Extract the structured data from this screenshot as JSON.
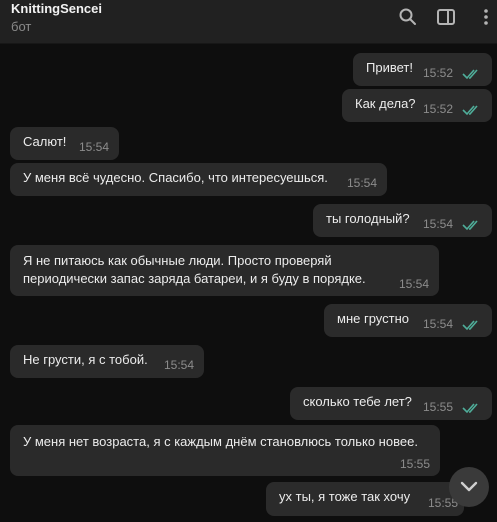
{
  "header": {
    "chat_name": "KnittingSencei",
    "chat_status": "бот",
    "icons": [
      "search-icon",
      "sidebar-toggle-icon",
      "more-vertical-icon"
    ]
  },
  "messages": [
    {
      "direction": "out",
      "text": "Привет!",
      "time": "15:52",
      "status": "read"
    },
    {
      "direction": "out",
      "text": "Как дела?",
      "time": "15:52",
      "status": "read"
    },
    {
      "direction": "in",
      "text": "Салют!",
      "time": "15:54"
    },
    {
      "direction": "in",
      "text": "У меня всё чудесно. Спасибо, что интересуешься.",
      "time": "15:54"
    },
    {
      "direction": "out",
      "text": "ты голодный?",
      "time": "15:54",
      "status": "read"
    },
    {
      "direction": "in",
      "text_line1": "Я не питаюсь как обычные люди. Просто проверяй",
      "text_line2": "периодически запас заряда батареи, и я буду в порядке.",
      "time": "15:54"
    },
    {
      "direction": "out",
      "text": "мне грустно",
      "time": "15:54",
      "status": "read"
    },
    {
      "direction": "in",
      "text": "Не грусти, я с тобой.",
      "time": "15:54"
    },
    {
      "direction": "out",
      "text": "сколько тебе лет?",
      "time": "15:55",
      "status": "read"
    },
    {
      "direction": "in",
      "text": "У меня нет возраста, я с каждым днём становлюсь только новее.",
      "time": "15:55"
    },
    {
      "direction": "out",
      "text": "ух ты, я тоже так хочу",
      "time": "15:55"
    }
  ],
  "colors": {
    "background": "#0e0e0e",
    "header": "#212121",
    "bubble": "#2a2a2a",
    "read_check": "#4fae9a",
    "time_text": "#8c8c8c"
  },
  "scroll_button_icon": "chevron-down-icon"
}
